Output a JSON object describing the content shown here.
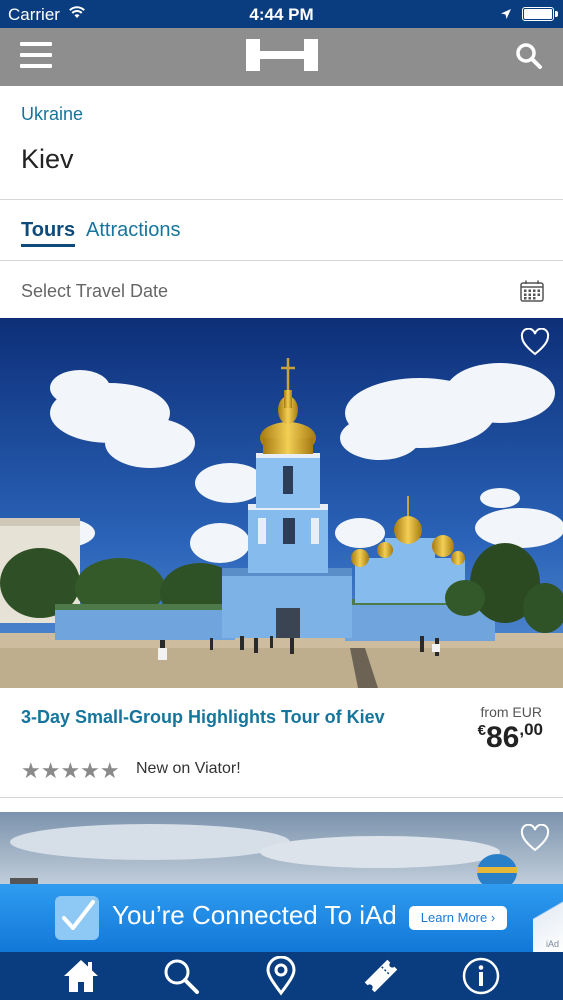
{
  "status_bar": {
    "carrier": "Carrier",
    "time": "4:44 PM"
  },
  "nav": {
    "icons": [
      "menu-icon",
      "hotel-logo",
      "search-icon"
    ]
  },
  "header": {
    "country": "Ukraine",
    "city": "Kiev"
  },
  "tabs": [
    {
      "label": "Tours",
      "active": true
    },
    {
      "label": "Attractions",
      "active": false
    }
  ],
  "date_picker": {
    "label": "Select Travel Date",
    "icon": "calendar-icon"
  },
  "tours": [
    {
      "title": "3-Day Small-Group Highlights Tour of Kiev",
      "rating_stars": 5,
      "stars_text": "★★★★★",
      "review_text": "New on Viator!",
      "price_prefix": "from EUR",
      "price_currency": "€",
      "price_integer": "86",
      "price_decimal": ",00"
    }
  ],
  "ad": {
    "text": "You’re Connected To iAd",
    "button": "Learn More",
    "button_arrow": "›",
    "badge": "iAd"
  },
  "tab_bar": {
    "items": [
      "home-icon",
      "search-icon",
      "location-pin-icon",
      "ticket-icon",
      "info-icon"
    ]
  },
  "colors": {
    "status_bar": "#0a3d80",
    "nav_bar": "#8e8e8e",
    "link": "#16759c",
    "active_tab": "#0e4a7a",
    "ad_blue": "#1a86e0"
  }
}
